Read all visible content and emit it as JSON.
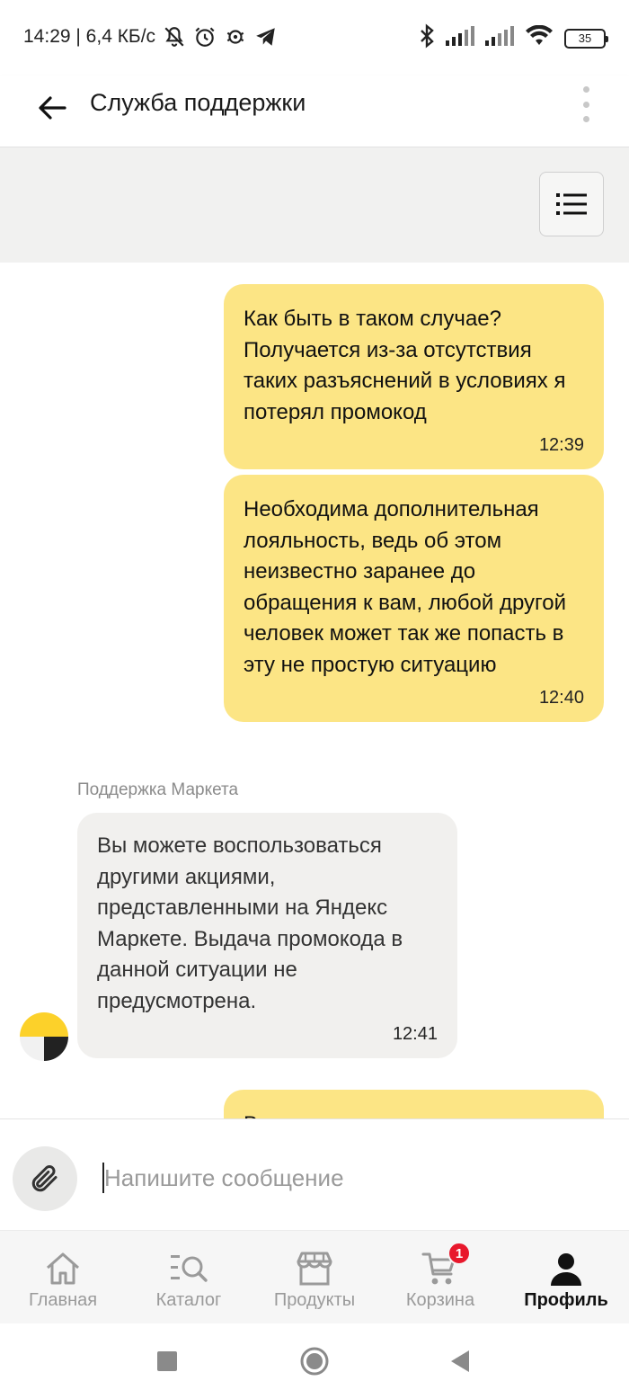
{
  "status_bar": {
    "time_speed": "14:29 | 6,4 КБ/с",
    "battery": "35"
  },
  "header": {
    "title": "Служба поддержки"
  },
  "messages": [
    {
      "direction": "out",
      "text": "Как быть в таком случае?\nПолучается из-за отсутствия таких разъяснений в условиях я потерял промокод",
      "time": "12:39"
    },
    {
      "direction": "out",
      "text": "Необходима дополнительная лояльность, ведь об этом неизвестно заранее до обращения к вам, любой другой человек может так же попасть в эту не простую ситуацию",
      "time": "12:40"
    },
    {
      "direction": "in",
      "sender": "Поддержка Маркета",
      "text": "Вы можете воспользоваться другими акциями, представленными на Яндекс Маркете. Выдача промокода в данной ситуации не предусмотрена.",
      "time": "12:41"
    },
    {
      "direction": "out",
      "text": "В",
      "time": ""
    }
  ],
  "composer": {
    "placeholder": "Напишите сообщение",
    "value": ""
  },
  "bottom_nav": {
    "items": [
      {
        "label": "Главная",
        "icon": "home-icon",
        "active": false
      },
      {
        "label": "Каталог",
        "icon": "catalog-search-icon",
        "active": false
      },
      {
        "label": "Продукты",
        "icon": "store-icon",
        "active": false
      },
      {
        "label": "Корзина",
        "icon": "cart-icon",
        "active": false,
        "badge": "1"
      },
      {
        "label": "Профиль",
        "icon": "profile-icon",
        "active": true
      }
    ]
  },
  "colors": {
    "outgoing_bubble": "#fce585",
    "incoming_bubble": "#f1f0ee",
    "badge": "#e8182c",
    "avatar_yellow": "#fcd12a"
  }
}
